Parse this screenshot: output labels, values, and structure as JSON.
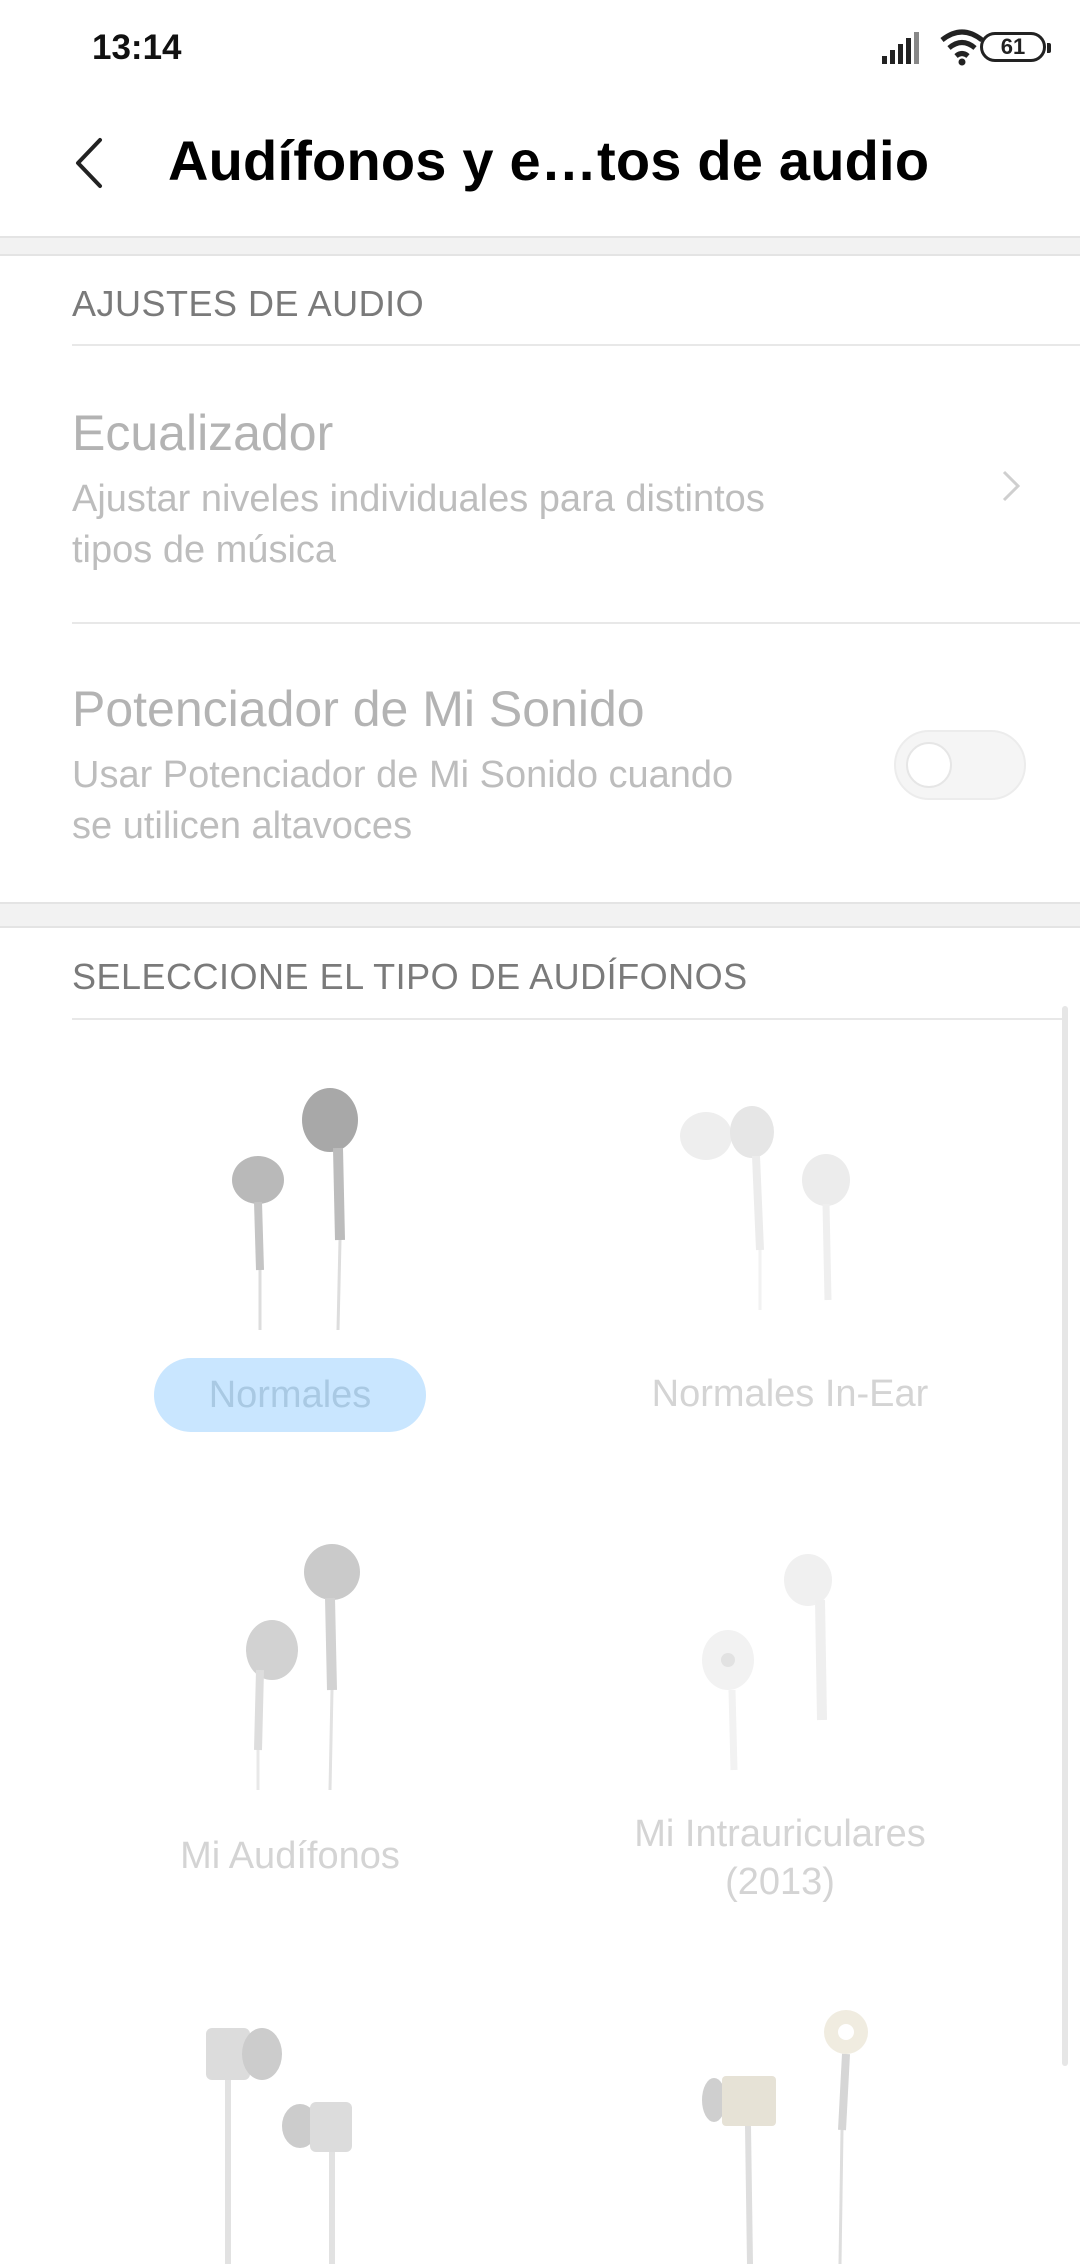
{
  "status_bar": {
    "time": "13:14",
    "battery": "61"
  },
  "app_bar": {
    "title": "Audífonos y e…tos de audio"
  },
  "audio_settings": {
    "header": "AJUSTES DE AUDIO",
    "equalizer": {
      "title": "Ecualizador",
      "subtitle_line1": "Ajustar niveles individuales para distintos",
      "subtitle_line2": "tipos de música"
    },
    "enhancer": {
      "title": "Potenciador de Mi Sonido",
      "subtitle_line1": "Usar Potenciador de Mi Sonido cuando",
      "subtitle_line2": "se utilicen altavoces",
      "enabled": false
    }
  },
  "headphone_types": {
    "header": "SELECCIONE EL TIPO DE AUDÍFONOS",
    "selected": "Normales",
    "items": [
      {
        "label": "Normales"
      },
      {
        "label": "Normales In-Ear"
      },
      {
        "label": "Mi Audífonos"
      },
      {
        "label_line1": "Mi Intrauriculares",
        "label_line2": "(2013)"
      }
    ]
  }
}
